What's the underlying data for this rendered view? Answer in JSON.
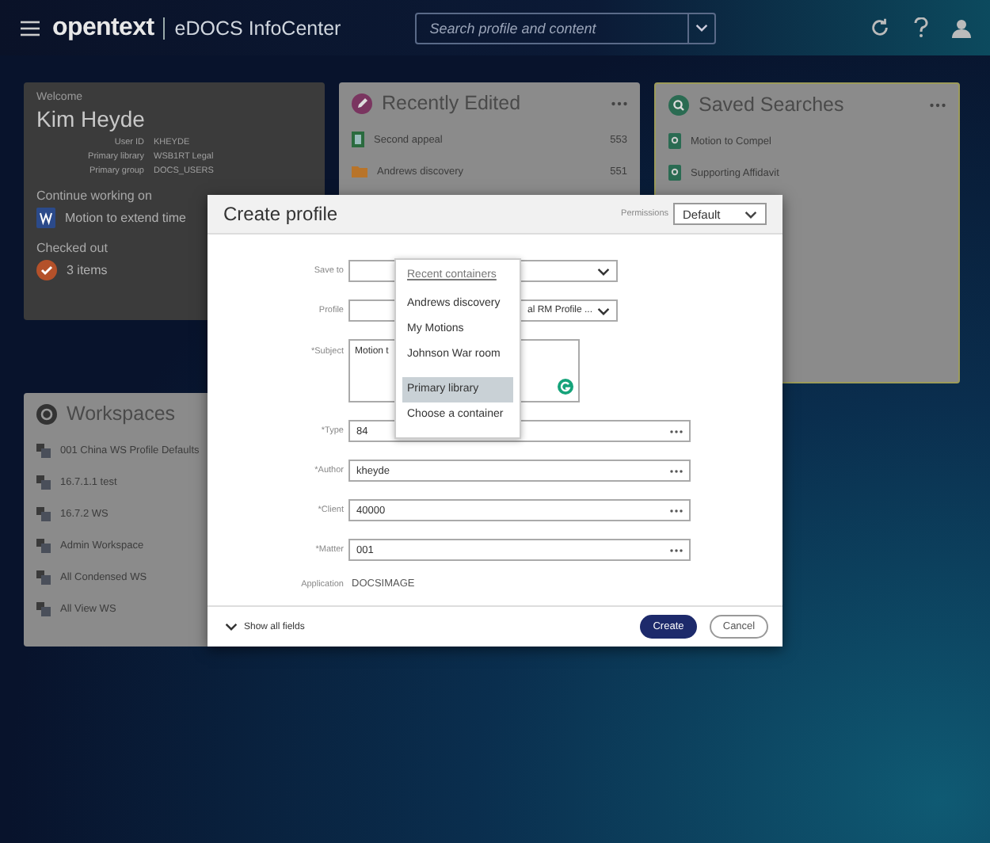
{
  "header": {
    "brand": "opentext",
    "product": "eDOCS InfoCenter",
    "search": {
      "placeholder": "Search profile and content"
    }
  },
  "welcome": {
    "greeting": "Welcome",
    "name": "Kim Heyde",
    "details": [
      {
        "label": "User ID",
        "value": "KHEYDE"
      },
      {
        "label": "Primary library",
        "value": "WSB1RT Legal"
      },
      {
        "label": "Primary group",
        "value": "DOCS_USERS"
      }
    ],
    "continue_title": "Continue working on",
    "continue_item": "Motion to extend time",
    "checked_out_title": "Checked out",
    "checked_out_item": "3 items"
  },
  "recently_edited": {
    "title": "Recently Edited",
    "items": [
      {
        "kind": "document",
        "name": "Second appeal",
        "number": "553"
      },
      {
        "kind": "folder",
        "name": "Andrews discovery",
        "number": "551"
      }
    ]
  },
  "saved_searches": {
    "title": "Saved Searches",
    "items": [
      "Motion to Compel",
      "Supporting Affidavit"
    ]
  },
  "workspaces": {
    "title": "Workspaces",
    "items": [
      "001 China WS Profile Defaults",
      "16.7.1.1 test",
      "16.7.2 WS",
      "Admin Workspace",
      "All Condensed WS",
      "All View WS"
    ]
  },
  "dialog": {
    "title": "Create profile",
    "permissions_label": "Permissions",
    "permissions_value": "Default",
    "fields": [
      {
        "kind": "select",
        "label": "Save to"
      },
      {
        "kind": "select",
        "label": "Profile",
        "value": "al RM Profile ..."
      },
      {
        "kind": "textarea",
        "label": "*Subject",
        "value": "Motion t"
      },
      {
        "kind": "lookup",
        "label": "*Type",
        "value": "84"
      },
      {
        "kind": "lookup",
        "label": "*Author",
        "value": "kheyde"
      },
      {
        "kind": "lookup",
        "label": "*Client",
        "value": "40000"
      },
      {
        "kind": "lookup",
        "label": "*Matter",
        "value": "001"
      },
      {
        "kind": "static",
        "label": "Application",
        "value": "DOCSIMAGE"
      }
    ],
    "menu": {
      "heading": "Recent containers",
      "items": [
        {
          "label": "Andrews discovery",
          "selected": false
        },
        {
          "label": "My Motions",
          "selected": false
        },
        {
          "label": "Johnson War room",
          "selected": false
        },
        {
          "label": "Primary library",
          "selected": true
        },
        {
          "label": "Choose a container",
          "selected": false
        }
      ]
    },
    "show_all": "Show all fields",
    "create": "Create",
    "cancel": "Cancel"
  }
}
